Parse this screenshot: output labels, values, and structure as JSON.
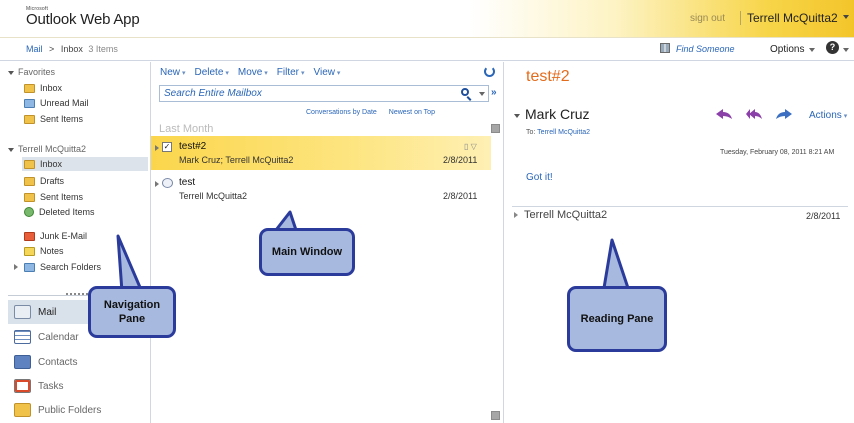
{
  "header": {
    "logo_microsoft": "Microsoft",
    "logo_app": "Outlook Web App",
    "sign_out": "sign out",
    "user_name": "Terrell McQuitta2"
  },
  "breadcrumb": {
    "root": "Mail",
    "separator": ">",
    "folder": "Inbox",
    "count": "3 Items"
  },
  "topbar": {
    "find_someone": "Find Someone",
    "options": "Options",
    "help": "?"
  },
  "nav": {
    "favorites_label": "Favorites",
    "favorites": [
      {
        "label": "Inbox"
      },
      {
        "label": "Unread Mail"
      },
      {
        "label": "Sent Items"
      }
    ],
    "mailbox_label": "Terrell McQuitta2",
    "folders": [
      {
        "label": "Inbox"
      },
      {
        "label": "Drafts"
      },
      {
        "label": "Sent Items"
      },
      {
        "label": "Deleted Items"
      },
      {
        "label": "Junk E-Mail"
      },
      {
        "label": "Notes"
      },
      {
        "label": "Search Folders"
      }
    ],
    "modules": [
      {
        "label": "Mail"
      },
      {
        "label": "Calendar"
      },
      {
        "label": "Contacts"
      },
      {
        "label": "Tasks"
      },
      {
        "label": "Public Folders"
      }
    ]
  },
  "toolbar": {
    "new": "New",
    "delete": "Delete",
    "move": "Move",
    "filter": "Filter",
    "view": "View"
  },
  "search": {
    "placeholder": "Search Entire Mailbox"
  },
  "sort": {
    "arrange": "Conversations by Date",
    "order": "Newest on Top"
  },
  "list": {
    "group": "Last Month",
    "messages": [
      {
        "subject": "test#2",
        "from": "Mark Cruz; Terrell McQuitta2",
        "date": "2/8/2011",
        "selected": true
      },
      {
        "subject": "test",
        "from": "Terrell McQuitta2",
        "date": "2/8/2011",
        "selected": false
      }
    ]
  },
  "reading": {
    "subject": "test#2",
    "sender": "Mark Cruz",
    "to_label": "To:",
    "to": "Terrell McQuitta2",
    "actions": "Actions",
    "timestamp": "Tuesday, February 08, 2011 8:21 AM",
    "body": "Got it!",
    "thread": {
      "name": "Terrell McQuitta2",
      "date": "2/8/2011"
    }
  },
  "callouts": {
    "navigation": "Navigation Pane",
    "main": "Main Window",
    "reading": "Reading Pane"
  },
  "colors": {
    "accent_blue": "#2a66b8",
    "subject_orange": "#e36c1c",
    "callout_fill": "#a7b9de",
    "callout_border": "#2a3b9c",
    "selected_row": "#fbd64c"
  }
}
